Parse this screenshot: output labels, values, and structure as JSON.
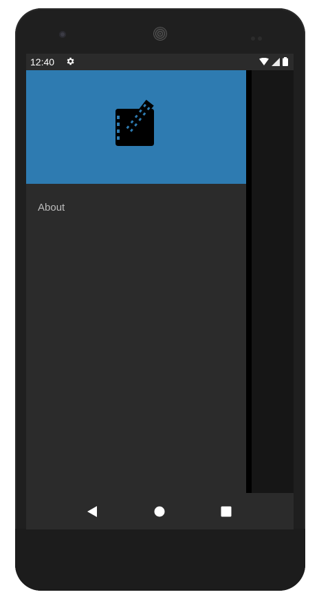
{
  "status_bar": {
    "time": "12:40",
    "icons": [
      "settings-icon",
      "wifi-icon",
      "signal-icon",
      "battery-icon"
    ]
  },
  "drawer": {
    "header_color": "#2e7bb1",
    "logo_icon": "film-book-icon",
    "menu_items": [
      {
        "label": "About"
      }
    ]
  },
  "nav_bar": {
    "buttons": [
      "back-icon",
      "home-icon",
      "recents-icon"
    ]
  }
}
